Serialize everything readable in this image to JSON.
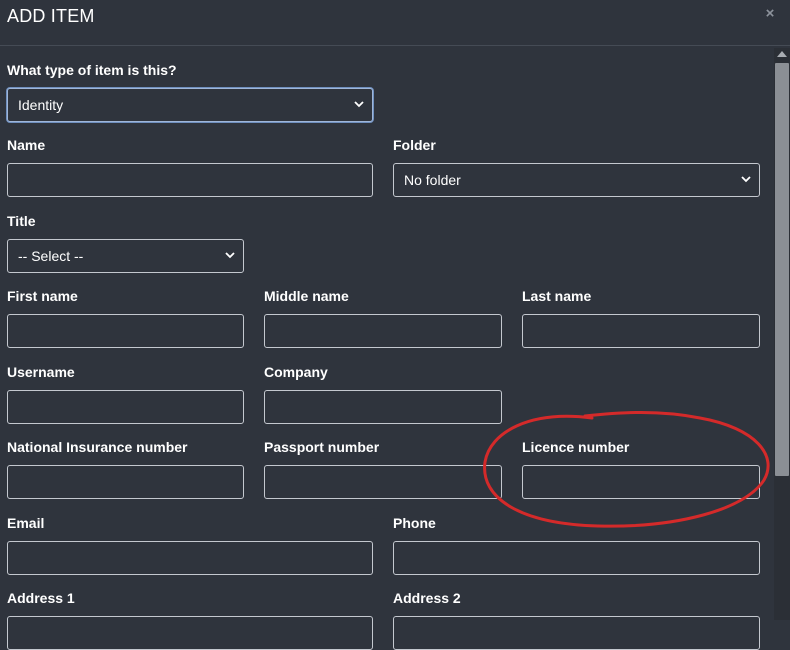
{
  "modal": {
    "title": "ADD ITEM",
    "close_glyph": "×"
  },
  "form": {
    "type": {
      "label": "What type of item is this?",
      "value": "Identity"
    },
    "name": {
      "label": "Name",
      "value": ""
    },
    "folder": {
      "label": "Folder",
      "value": "No folder"
    },
    "title": {
      "label": "Title",
      "value": "-- Select --"
    },
    "first_name": {
      "label": "First name",
      "value": ""
    },
    "middle_name": {
      "label": "Middle name",
      "value": ""
    },
    "last_name": {
      "label": "Last name",
      "value": ""
    },
    "username": {
      "label": "Username",
      "value": ""
    },
    "company": {
      "label": "Company",
      "value": ""
    },
    "national_insurance": {
      "label": "National Insurance number",
      "value": ""
    },
    "passport": {
      "label": "Passport number",
      "value": ""
    },
    "licence": {
      "label": "Licence number",
      "value": ""
    },
    "email": {
      "label": "Email",
      "value": ""
    },
    "phone": {
      "label": "Phone",
      "value": ""
    },
    "address1": {
      "label": "Address 1",
      "value": ""
    },
    "address2": {
      "label": "Address 2",
      "value": ""
    }
  },
  "icons": {
    "close": "close-icon",
    "chevron": "chevron-down-icon"
  },
  "colors": {
    "background": "#2f343d",
    "border": "#c4c8cf",
    "annotation": "#d42a2a"
  }
}
